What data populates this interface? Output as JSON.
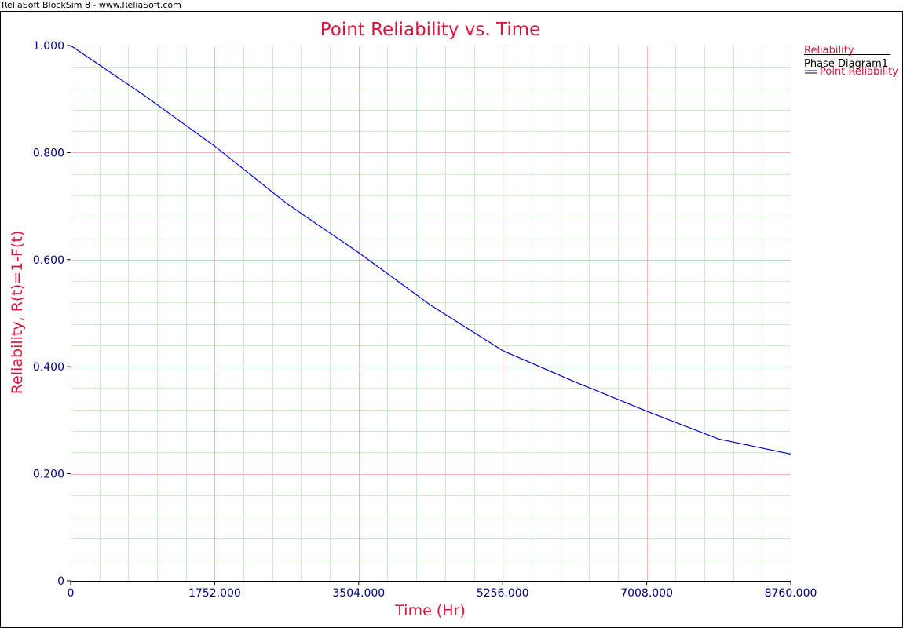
{
  "window": {
    "title": "ReliaSoft BlockSim 8 - www.ReliaSoft.com"
  },
  "colors": {
    "title": "#dc143c",
    "ticks": "#000080",
    "series": "#0000cd",
    "major_grid": "#f4b6b6",
    "minor_grid": "#c8eec8"
  },
  "chart_data": {
    "type": "line",
    "title": "Point Reliability vs. Time",
    "xlabel": "Time (Hr)",
    "ylabel": "Reliability, R(t)=1-F(t)",
    "xlim": [
      0,
      8760
    ],
    "ylim": [
      0,
      1
    ],
    "x_ticks": [
      "0",
      "1752.000",
      "3504.000",
      "5256.000",
      "7008.000",
      "8760.000"
    ],
    "y_ticks": [
      "0",
      "0.200",
      "0.400",
      "0.600",
      "0.800",
      "1.000"
    ],
    "grid": true,
    "legend": {
      "placement": "top-right",
      "heading": "Reliability",
      "group": "Phase Diagram1",
      "entries": [
        "Point Reliability"
      ]
    },
    "series": [
      {
        "name": "Point Reliability",
        "x": [
          0,
          876,
          1752,
          2628,
          3504,
          4380,
          5256,
          6132,
          7008,
          7884,
          8760
        ],
        "y": [
          1.0,
          0.909,
          0.812,
          0.705,
          0.613,
          0.515,
          0.43,
          0.372,
          0.317,
          0.265,
          0.237
        ]
      }
    ]
  }
}
